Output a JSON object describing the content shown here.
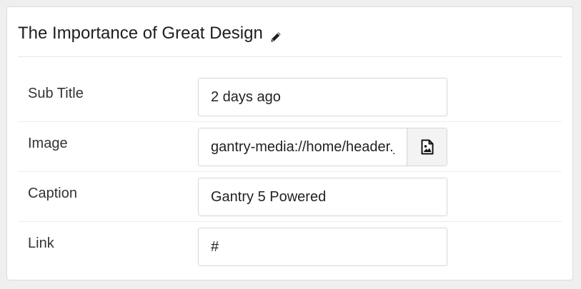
{
  "panel": {
    "title": "The Importance of Great Design",
    "edit_icon": "pencil-icon"
  },
  "fields": {
    "subtitle": {
      "label": "Sub Title",
      "value": "2 days ago"
    },
    "image": {
      "label": "Image",
      "value": "gantry-media://home/header.jpg",
      "picker_icon": "image-file-icon"
    },
    "caption": {
      "label": "Caption",
      "value": "Gantry 5 Powered"
    },
    "link": {
      "label": "Link",
      "value": "#"
    }
  }
}
